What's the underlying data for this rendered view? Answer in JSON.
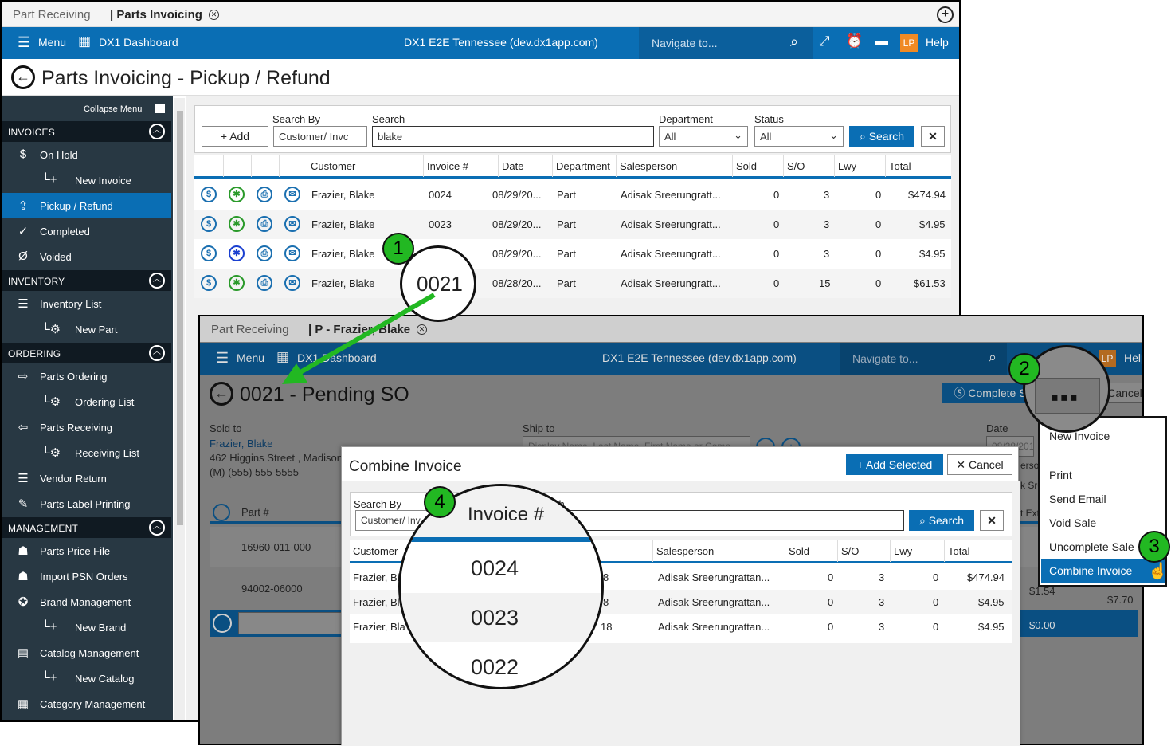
{
  "main": {
    "tabs": [
      "Part Receiving",
      "| Parts Invoicing"
    ],
    "topbar": {
      "menu": "Menu",
      "dashboard": "DX1 Dashboard",
      "site": "DX1 E2E Tennessee (dev.dx1app.com)",
      "navigate_placeholder": "Navigate to...",
      "avatar": "LP",
      "help": "Help"
    },
    "page_title": "Parts Invoicing - Pickup / Refund",
    "collapse_menu": "Collapse Menu",
    "sidebar": {
      "sections": [
        "INVOICES",
        "INVENTORY",
        "ORDERING",
        "MANAGEMENT"
      ],
      "items": [
        "On Hold",
        "New Invoice",
        "Pickup / Refund",
        "Completed",
        "Voided",
        "Inventory List",
        "New Part",
        "Parts Ordering",
        "Ordering List",
        "Parts Receiving",
        "Receiving List",
        "Vendor Return",
        "Parts Label Printing",
        "Parts Price File",
        "Import PSN Orders",
        "Brand Management",
        "New Brand",
        "Catalog Management",
        "New Catalog",
        "Category Management"
      ]
    },
    "filters": {
      "add": "Add",
      "search_by_label": "Search By",
      "search_by_value": "Customer/ Invc",
      "search_label": "Search",
      "search_value": "blake",
      "dept_label": "Department",
      "dept_value": "All",
      "status_label": "Status",
      "status_value": "All",
      "search_btn": "Search"
    },
    "table": {
      "headers": [
        "Customer",
        "Invoice #",
        "Date",
        "Department",
        "Salesperson",
        "Sold",
        "S/O",
        "Lwy",
        "Total"
      ],
      "rows": [
        {
          "customer": "Frazier, Blake",
          "invoice": "0024",
          "date": "08/29/20...",
          "dept": "Part",
          "sales": "Adisak Sreerungratt...",
          "sold": "0",
          "so": "3",
          "lwy": "0",
          "total": "$474.94"
        },
        {
          "customer": "Frazier, Blake",
          "invoice": "0023",
          "date": "08/29/20...",
          "dept": "Part",
          "sales": "Adisak Sreerungratt...",
          "sold": "0",
          "so": "3",
          "lwy": "0",
          "total": "$4.95"
        },
        {
          "customer": "Frazier, Blake",
          "invoice": "",
          "date": "08/29/20...",
          "dept": "Part",
          "sales": "Adisak Sreerungratt...",
          "sold": "0",
          "so": "3",
          "lwy": "0",
          "total": "$4.95"
        },
        {
          "customer": "Frazier, Blake",
          "invoice": "",
          "date": "08/28/20...",
          "dept": "Part",
          "sales": "Adisak Sreerungratt...",
          "sold": "0",
          "so": "15",
          "lwy": "0",
          "total": "$61.53"
        }
      ]
    }
  },
  "callouts": {
    "one": "1",
    "two": "2",
    "three": "3",
    "four": "4",
    "mag1": "0021",
    "mag4_header": "Invoice #",
    "mag4_rows": [
      "0024",
      "0023",
      "0022"
    ]
  },
  "second": {
    "tabs": [
      "Part Receiving",
      "| P - Frazier, Blake"
    ],
    "topbar": {
      "menu": "Menu",
      "dashboard": "DX1 Dashboard",
      "site": "DX1 E2E Tennessee (dev.dx1app.com)",
      "navigate_placeholder": "Navigate to...",
      "avatar": "LP",
      "help": "Help"
    },
    "title": "0021 - Pending SO",
    "complete": "Complete S",
    "cancel": "Cancel",
    "sold_to_label": "Sold to",
    "customer_name": "Frazier, Blake",
    "address": "462 Higgins Street , Madison",
    "phone": "(M) (555) 555-5555",
    "ship_to_label": "Ship to",
    "ship_placeholder": "Display Name, Last Name, First Name or Comp",
    "date_label": "Date",
    "date_value": "08/28/201",
    "part_header": "Part #",
    "parts": [
      "16960-011-000",
      "94002-06000"
    ],
    "right_values": [
      "$1.54",
      "$7.70",
      "$0.00"
    ],
    "right_headers": [
      "erso",
      "k Sre",
      "t Ext"
    ]
  },
  "menu": {
    "items": [
      "New Invoice",
      "Print",
      "Send Email",
      "Void Sale",
      "Uncomplete Sale",
      "Combine Invoice"
    ]
  },
  "dialog": {
    "title": "Combine Invoice",
    "add_selected": "Add Selected",
    "cancel": "Cancel",
    "search_by_label": "Search By",
    "search_by_value": "Customer/ Inv",
    "search_label": "ch",
    "search_btn": "Search",
    "headers": [
      "Customer",
      "Salesperson",
      "Sold",
      "S/O",
      "Lwy",
      "Total"
    ],
    "rows": [
      {
        "customer": "Frazier, Bl",
        "date": "8",
        "sales": "Adisak Sreerungrattan...",
        "sold": "0",
        "so": "3",
        "lwy": "0",
        "total": "$474.94"
      },
      {
        "customer": "Frazier, Bl",
        "date": "8",
        "sales": "Adisak Sreerungrattan...",
        "sold": "0",
        "so": "3",
        "lwy": "0",
        "total": "$4.95"
      },
      {
        "customer": "Frazier, Bla",
        "date": "18",
        "sales": "Adisak Sreerungrattan...",
        "sold": "0",
        "so": "3",
        "lwy": "0",
        "total": "$4.95"
      }
    ]
  },
  "colors": {
    "primary": "#0a6eb4",
    "sidebar": "#283843",
    "callout_green": "#22b822"
  }
}
